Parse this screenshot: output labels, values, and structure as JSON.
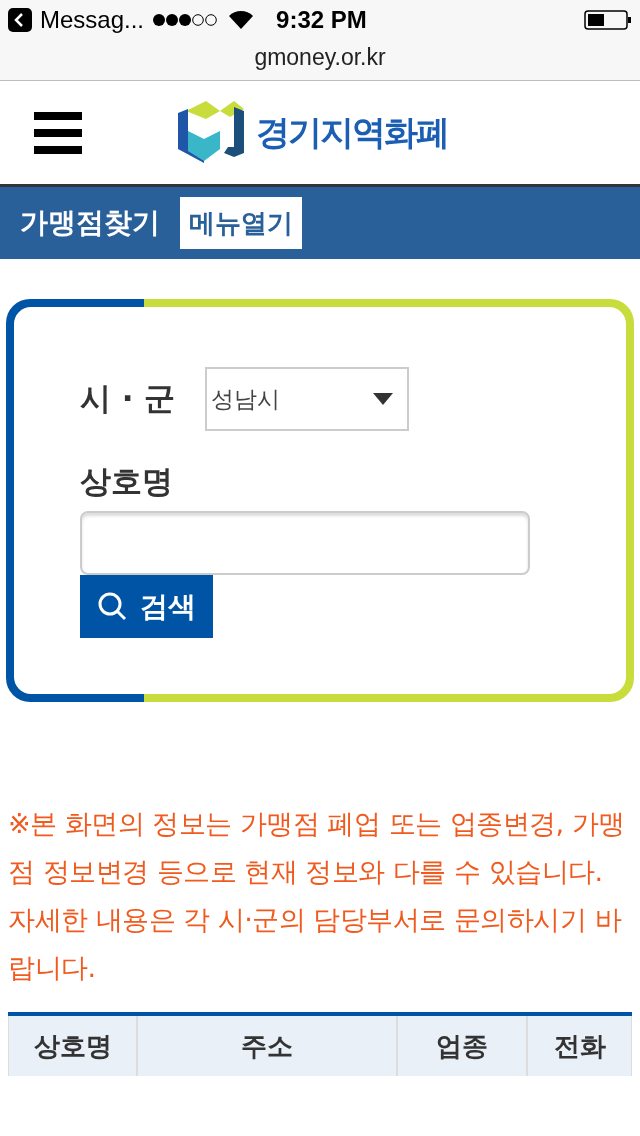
{
  "status_bar": {
    "back_label": "Messag...",
    "time": "9:32 PM"
  },
  "url": "gmoney.or.kr",
  "header": {
    "logo_text": "경기지역화폐"
  },
  "nav": {
    "title": "가맹점찾기",
    "menu_button": "메뉴열기"
  },
  "search": {
    "city_label": "시 · 군",
    "city_value": "성남시",
    "name_label": "상호명",
    "search_button": "검색"
  },
  "notice": [
    "※본 화면의 정보는 가맹점 폐업 또는 업종변경, 가맹점 정보변경 등으로 현재 정보와 다를 수 있습니다.",
    "자세한 내용은 각 시·군의 담당부서로 문의하시기 바랍니다."
  ],
  "table": {
    "columns": [
      "상호명",
      "주소",
      "업종",
      "전화"
    ]
  }
}
